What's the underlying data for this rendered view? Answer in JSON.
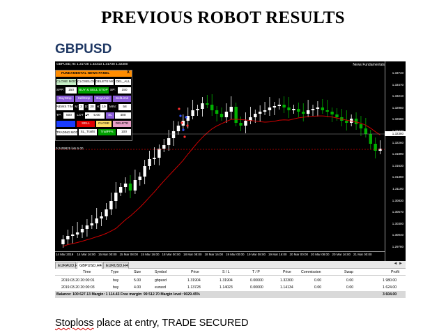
{
  "heading": "PREVIOUS ROBOT RESULTS",
  "symbol_heading": "GBPUSD",
  "chart": {
    "header_text": "GBPUSD,H4  1.31738 1.32313 1.31738 1.32380",
    "indicator_label": "News Fundamentals",
    "lots_label": "0.2409825 lots 5.00",
    "y_ticks": [
      "1.33740",
      "1.33470",
      "1.33210",
      "1.32950",
      "1.32680",
      "1.32420",
      "1.32260",
      "1.31890",
      "1.31630",
      "1.31360",
      "1.31100",
      "1.30830",
      "1.30570",
      "1.30300",
      "1.30040",
      "1.29780"
    ],
    "current_price": "1.32380",
    "x_ticks": [
      "14 Mar 2019",
      "14 Mar 16:00",
      "15 Mar 00:00",
      "15 Mar 08:00",
      "15 Mar 16:00",
      "18 Mar 00:00",
      "18 Mar 08:00",
      "18 Mar 16:00",
      "19 Mar 00:00",
      "19 Mar 08:00",
      "19 Mar 16:00",
      "20 Mar 00:00",
      "20 Mar 08:00",
      "20 Mar 16:00",
      "21 Mar 00:00"
    ],
    "colors": {
      "background": "#000000",
      "bull": "#ffffff",
      "bear": "#00b000",
      "ma": "#d00000",
      "dotted": "#d00000"
    }
  },
  "panel": {
    "title": "FUNDAMENTAL NEWS PANEL",
    "close_glyph": "X",
    "close_mode": "CLOSE MODE",
    "closeloss": "CLOSELOSS",
    "delete_mode": "DELETE MODE",
    "del_all": "DEL_ALL",
    "spp_label": "SPP:",
    "spp_value": "150",
    "buy_sell_stop": "BUY & SELL STOP",
    "sp_label": "SP:",
    "sp_value": "150",
    "buystop": "BuyStop",
    "sellstop": "SellStop",
    "buylimit": "BuyLimit",
    "selllimit": "SellLimit",
    "news_time": "NEWS TIME",
    "m_label": "M:",
    "m_value": "3",
    "d_label": "D:",
    "d_value": "20",
    "h_label": "H:",
    "h_value": "19",
    "min_label": "MIN:",
    "min_value": "58",
    "tp_label": "TP:",
    "tp_value": "500",
    "lot_label": "LOT",
    "lot_value": "5.00",
    "sl_label": "SL",
    "sl_value": "400",
    "buy": "BUY",
    "sell": "SELL",
    "close": "CLOSE",
    "delete": "DELETE",
    "trading_mode": "TRADING MODE",
    "sl_trails": "SL_TrailS",
    "trailpips": "TrailPPs",
    "trail_value": "100"
  },
  "tabs": [
    "EURAUD,H4",
    "GBPUSD,H4",
    "EURUSD,H4"
  ],
  "tab_arrows": "◄ ►",
  "terminal": {
    "headers": [
      "Time",
      "Type",
      "Size",
      "Symbol",
      "Price",
      "S / L",
      "T / P",
      "Price",
      "Commission",
      "Swap",
      "Profit"
    ],
    "rows": [
      [
        "2019.03.20 20:00:01",
        "buy",
        "5.00",
        "gbpusd",
        "1.31904",
        "1.31904",
        "0.00000",
        "1.32300",
        "0.00",
        "0.00",
        "1 980.00"
      ],
      [
        "2019.03.20 20:00:03",
        "buy",
        "4.00",
        "eurusd",
        "1.13728",
        "1.14023",
        "0.00000",
        "1.14134",
        "0.00",
        "0.00",
        "1 624.00"
      ]
    ],
    "summary": "Balance: 100 627.13  Margin: 1 114.43  Free margin: 99 512.70  Margin level: 9029.45%",
    "total_profit": "3 604.00"
  },
  "caption": {
    "underlined": "Stoploss",
    "rest": " place at entry, TRADE SECURED"
  }
}
